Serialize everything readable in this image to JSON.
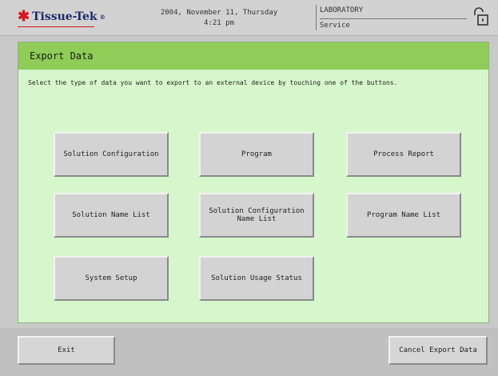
{
  "header": {
    "logo_text": "Tissue-Tek",
    "logo_mark": "®",
    "date_line": "2004, November 11, Thursday",
    "time_line": "4:21 pm",
    "location_line1": "LABORATORY",
    "location_line2": "Service",
    "lock_icon": "padlock-open-icon"
  },
  "panel": {
    "title": "Export Data",
    "instructions": "Select the type of data you want to export to an external device by touching one of the buttons.",
    "buttons": [
      "Solution Configuration",
      "Program",
      "Process Report",
      "Solution Name List",
      "Solution Configuration\nName List",
      "Program Name List",
      "System Setup",
      "Solution Usage Status"
    ]
  },
  "footer": {
    "exit_label": "Exit",
    "cancel_label": "Cancel Export Data"
  },
  "colors": {
    "panel_bg": "#d6f7cc",
    "panel_header": "#8fcc58",
    "logo_red": "#d8161c",
    "logo_blue": "#1c2a6a"
  }
}
